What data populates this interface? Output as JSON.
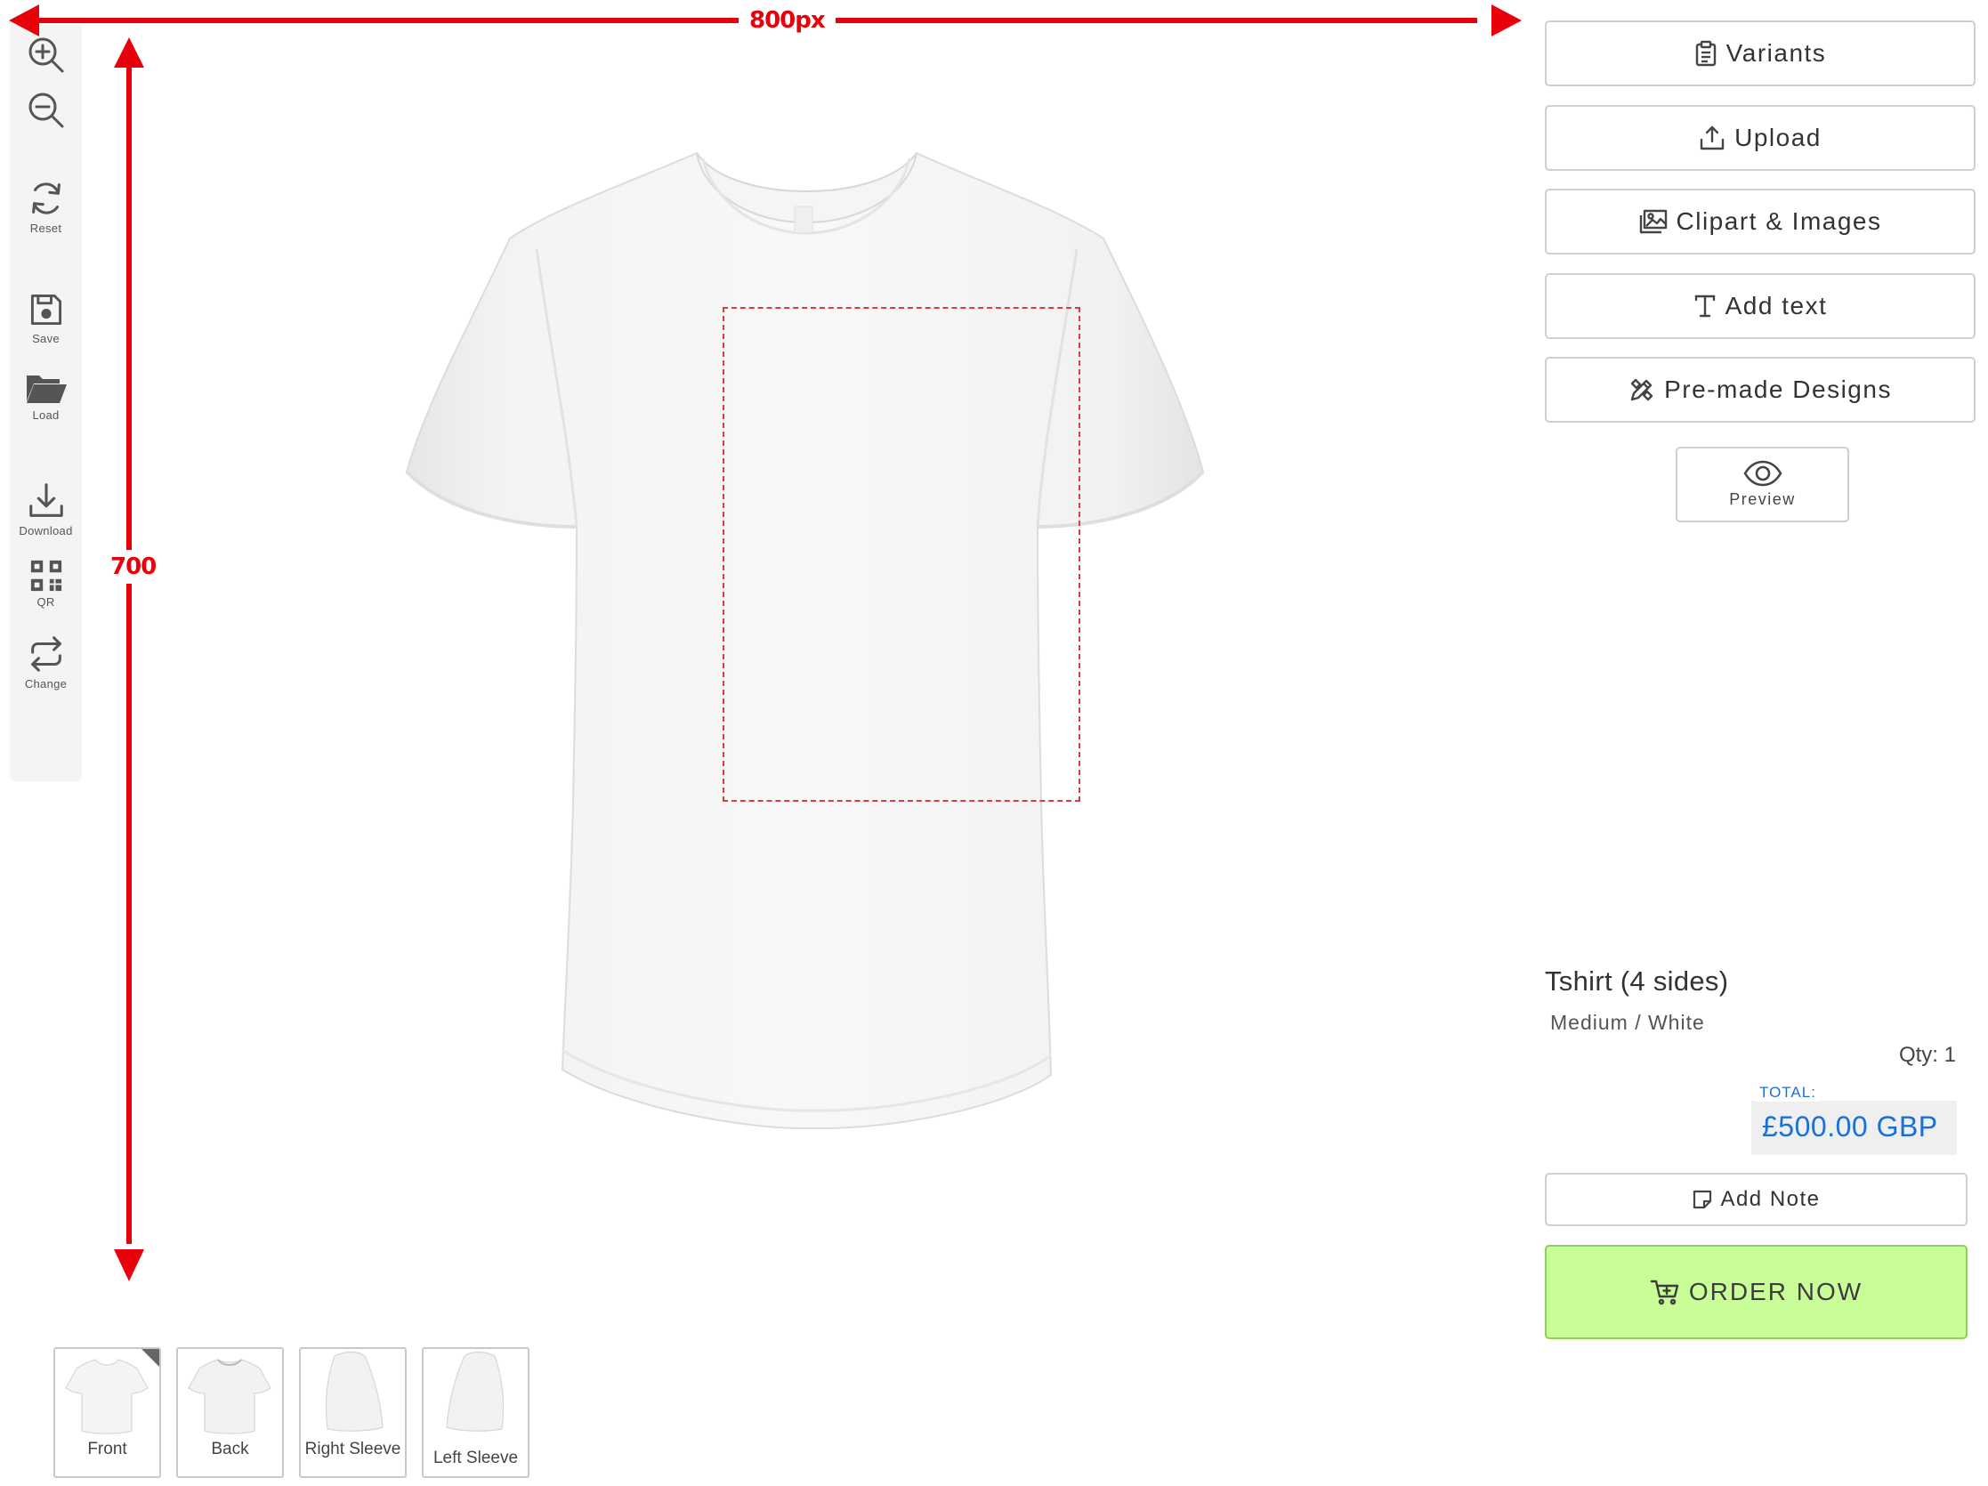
{
  "toolbar": {
    "tools": [
      {
        "id": "zoom-in",
        "icon": "zoom-in-icon",
        "label": ""
      },
      {
        "id": "zoom-out",
        "icon": "zoom-out-icon",
        "label": ""
      },
      {
        "id": "reset",
        "icon": "reset-icon",
        "label": "Reset"
      },
      {
        "id": "save",
        "icon": "save-icon",
        "label": "Save"
      },
      {
        "id": "load",
        "icon": "folder-icon",
        "label": "Load"
      },
      {
        "id": "download",
        "icon": "download-icon",
        "label": "Download"
      },
      {
        "id": "qr",
        "icon": "qr-code-icon",
        "label": "QR"
      },
      {
        "id": "change",
        "icon": "swap-icon",
        "label": "Change"
      }
    ]
  },
  "annotations": {
    "width_label": "800px",
    "height_label": "700",
    "arrow_color": "#e8000b"
  },
  "actions": {
    "variants": "Variants",
    "upload": "Upload",
    "clipart": "Clipart & Images",
    "add_text": "Add text",
    "premade": "Pre-made Designs",
    "preview": "Preview"
  },
  "product": {
    "title": "Tshirt (4 sides)",
    "variant": "Medium / White",
    "qty": "Qty: 1",
    "total_label": "TOTAL:",
    "total_value": "£500.00 GBP",
    "add_note": "Add Note",
    "order_now": "ORDER NOW"
  },
  "sides": [
    {
      "label": "Front",
      "active": true
    },
    {
      "label": "Back",
      "active": false
    },
    {
      "label": "Right Sleeve",
      "active": false
    },
    {
      "label": "Left Sleeve",
      "active": false
    }
  ],
  "colors": {
    "accent_blue": "#1a6fd8",
    "order_green": "#c9fd98",
    "print_area_border": "#e0393e"
  }
}
